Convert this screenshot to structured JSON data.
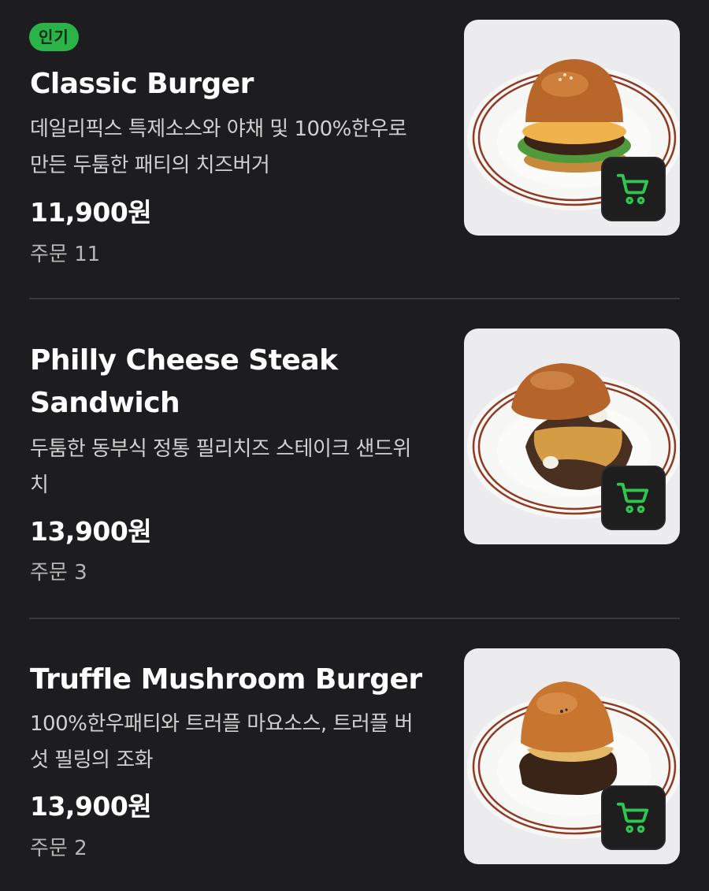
{
  "items": [
    {
      "badge": "인기",
      "name": "Classic Burger",
      "description": "데일리픽스 특제소스와 야채 및 100%한우로 만든 두툼한 패티의 치즈버거",
      "price": "11,900원",
      "orders": "주문 11",
      "image_icon": "classic-burger-photo",
      "cart_icon": "cart-icon"
    },
    {
      "name": "Philly Cheese Steak Sandwich",
      "description": "두툼한 동부식 정통 필리치즈 스테이크 샌드위치",
      "price": "13,900원",
      "orders": "주문 3",
      "image_icon": "philly-sandwich-photo",
      "cart_icon": "cart-icon"
    },
    {
      "name": "Truffle Mushroom Burger",
      "description": "100%한우패티와 트러플 마요소스, 트러플 버섯 필링의 조화",
      "price": "13,900원",
      "orders": "주문 2",
      "image_icon": "truffle-burger-photo",
      "cart_icon": "cart-icon"
    }
  ],
  "colors": {
    "background": "#1d1d1f",
    "badge": "#2bb34a",
    "cart_accent": "#2fc64f",
    "divider": "#3a3a3c"
  }
}
